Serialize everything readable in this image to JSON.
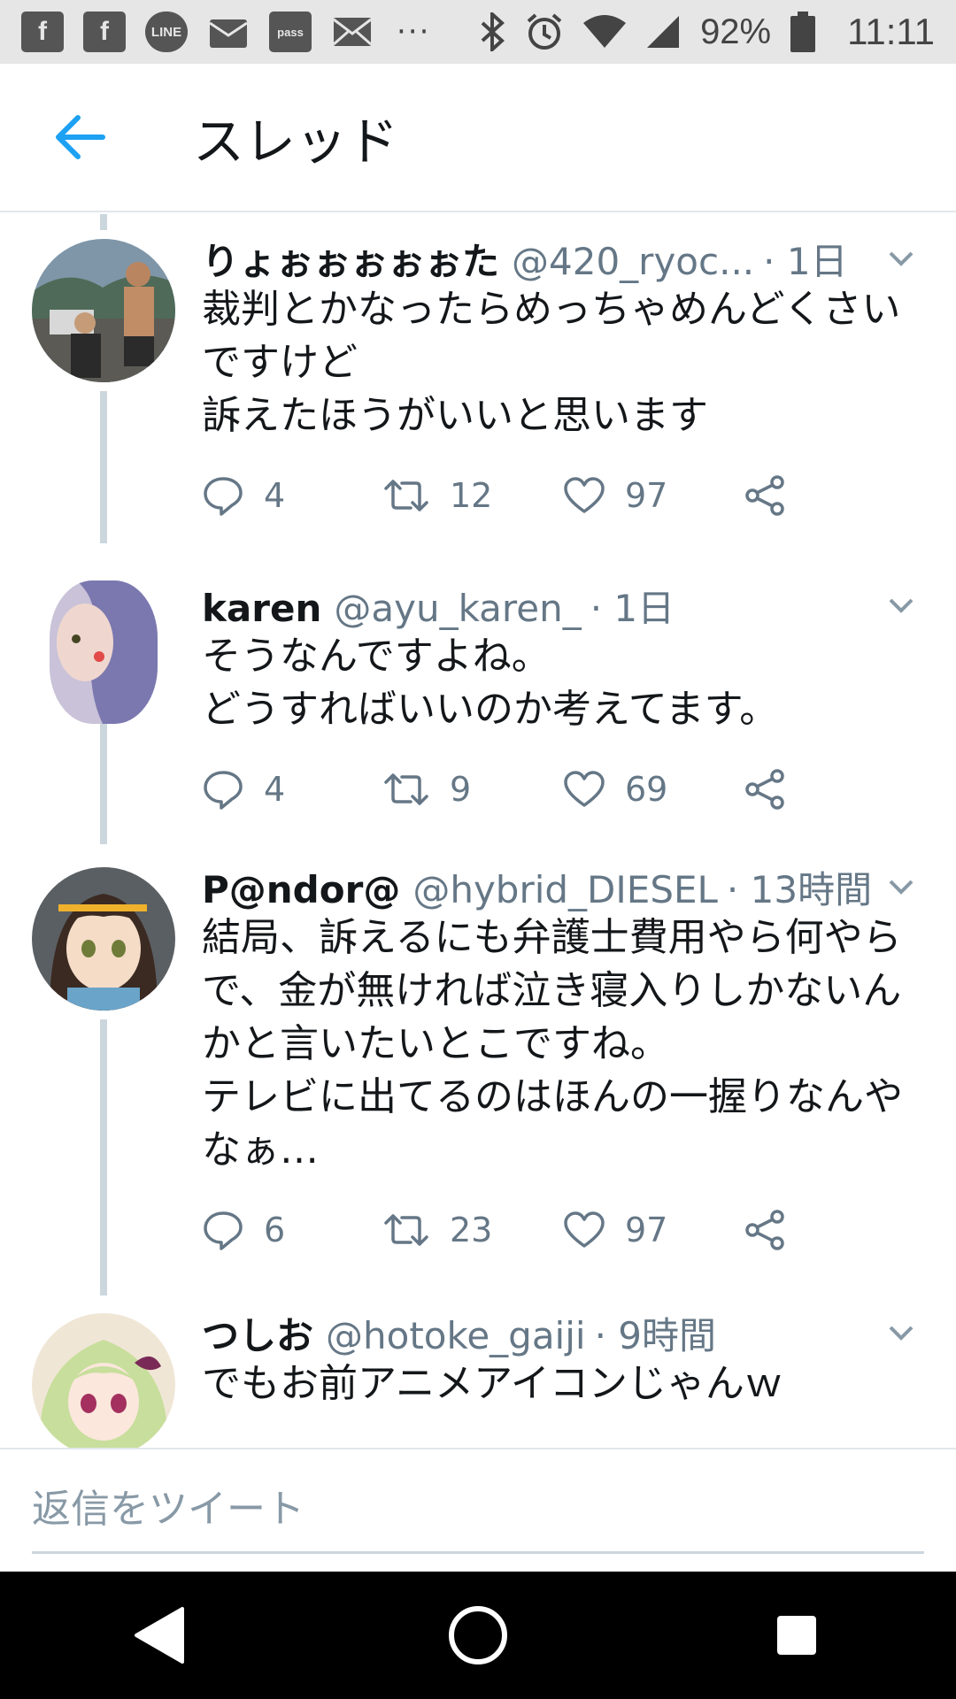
{
  "status_bar": {
    "battery": "92%",
    "time": "11:11",
    "dots": "···",
    "icons": [
      "facebook-icon",
      "facebook-icon",
      "line-icon",
      "au-mail-icon",
      "pass-icon",
      "mail-icon",
      "bluetooth-icon",
      "alarm-icon",
      "wifi-icon",
      "signal-icon",
      "battery-icon"
    ],
    "line_label": "LINE",
    "pass_label": "pass"
  },
  "header": {
    "title": "スレッド",
    "accent": "#1da1f2"
  },
  "tweets": [
    {
      "name": "りょぉぉぉぉぉた",
      "handle": "@420_ryoc...",
      "time": "· 1日",
      "text": "裁判とかなったらめっちゃめんどくさい\nですけど\n訴えたほうがいいと思います",
      "replies": "4",
      "retweets": "12",
      "likes": "97"
    },
    {
      "name": "karen",
      "handle": "@ayu_karen_",
      "time": "· 1日",
      "text": "そうなんですよね。\nどうすればいいのか考えてます。",
      "replies": "4",
      "retweets": "9",
      "likes": "69"
    },
    {
      "name": "P@ndor@",
      "handle": "@hybrid_DIESEL",
      "time": "· 13時間",
      "text": "結局、訴えるにも弁護士費用やら何やら\nで、金が無ければ泣き寝入りしかないん\nかと言いたいとこですね。\nテレビに出てるのはほんの一握りなんや\nなぁ…",
      "replies": "6",
      "retweets": "23",
      "likes": "97"
    },
    {
      "name": "つしお",
      "handle": "@hotoke_gaiji",
      "time": "· 9時間",
      "text": "でもお前アニメアイコンじゃんｗ"
    }
  ],
  "reply": {
    "placeholder": "返信をツイート"
  },
  "colors": {
    "secondary_text": "#657786",
    "thread_line": "#ccd6dd",
    "divider": "#e1e8ed"
  }
}
